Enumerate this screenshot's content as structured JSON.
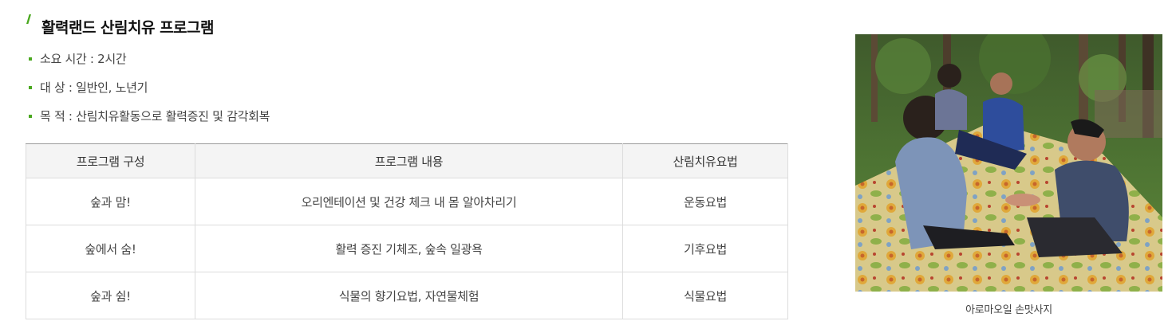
{
  "title": "활력랜드 산림치유 프로그램",
  "info": [
    "소요 시간 : 2시간",
    "대 상 : 일반인, 노년기",
    "목 적 : 산림치유활동으로 활력증진 및 감각회복"
  ],
  "table": {
    "headers": [
      "프로그램 구성",
      "프로그램 내용",
      "산림치유요법"
    ],
    "rows": [
      [
        "숲과 맘!",
        "오리엔테이션 및 건강 체크 내 몸 알아차리기",
        "운동요법"
      ],
      [
        "숲에서 숨!",
        "활력 증진 기체조, 숲속 일광욕",
        "기후요법"
      ],
      [
        "숲과 쉼!",
        "식물의 향기요법, 자연물체험",
        "식물요법"
      ]
    ]
  },
  "photo": {
    "caption": "아로마오일 손맛사지"
  },
  "colors": {
    "accent": "#4aa81f",
    "header_bg": "#f4f4f4",
    "border": "#dcdcdc"
  }
}
